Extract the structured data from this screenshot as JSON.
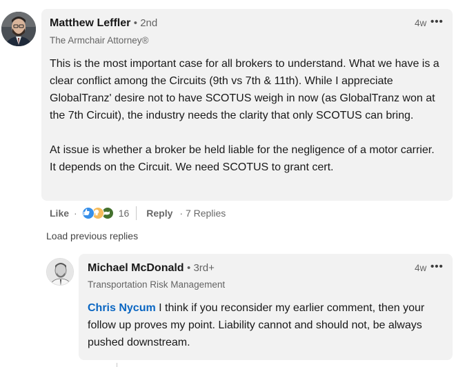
{
  "comment1": {
    "author": "Matthew Leffler",
    "degree": "• 2nd",
    "headline": "The Armchair Attorney®",
    "time": "4w",
    "more": "•••",
    "paragraph1": "This is the most important case for all brokers to understand. What we have is a clear conflict among the Circuits (9th vs 7th & 11th). While I appreciate GlobalTranz' desire not to have SCOTUS weigh in now (as GlobalTranz won at the 7th Circuit), the industry needs the clarity that only SCOTUS can bring.",
    "paragraph2": "At issue is whether a broker be held liable for the negligence of a motor carrier. It depends on the Circuit. We need SCOTUS to grant cert.",
    "like_label": "Like",
    "dot": "·",
    "reaction_count": "16",
    "reply_label": "Reply",
    "replies_count": "· 7 Replies",
    "reactions": [
      "like-reaction-icon",
      "insightful-reaction-icon",
      "support-reaction-icon"
    ]
  },
  "load_previous": "Load previous replies",
  "reply1": {
    "author": "Michael McDonald",
    "degree": "• 3rd+",
    "headline": "Transportation Risk Management",
    "time": "4w",
    "more": "•••",
    "mention": "Chris Nycum",
    "text": " I think if you reconsider my earlier comment, then your follow up proves my point. Liability cannot and should not, be always pushed downstream."
  },
  "colors": {
    "bubble": "#f2f2f2",
    "link": "#0a66c2",
    "like_blue": "#378fe9",
    "insight_yellow": "#f5bb5c",
    "support_green": "#44712e"
  }
}
